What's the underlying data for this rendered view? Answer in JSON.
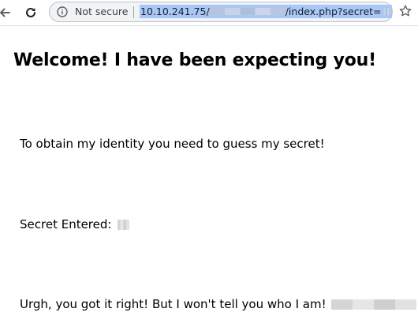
{
  "browser": {
    "security_label": "Not secure",
    "url_host": "10.10.241.75/",
    "url_path": "/index.php?secret=",
    "icons": {
      "back": "back-arrow-icon",
      "reload": "reload-icon",
      "info": "info-icon",
      "bookmark": "star-icon"
    }
  },
  "page": {
    "title": "Welcome! I have been expecting you!",
    "instruction": "To obtain my identity you need to guess my secret!",
    "secret_label": "Secret Entered:",
    "result": "Urgh, you got it right! But I won't tell you who I am!"
  }
}
